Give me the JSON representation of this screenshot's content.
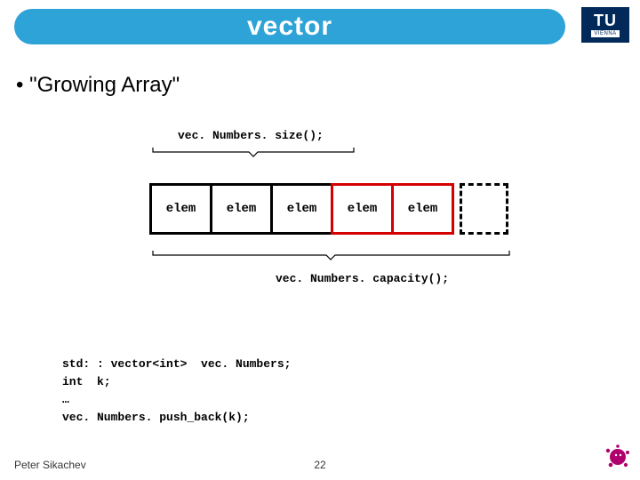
{
  "title": "vector",
  "logo": {
    "top": "TU",
    "bottom": "VIENNA"
  },
  "bullet": "• \"Growing Array\"",
  "sizeCall": "vec. Numbers. size();",
  "capacityCall": "vec. Numbers. capacity();",
  "cells": [
    "elem",
    "elem",
    "elem",
    "elem",
    "elem"
  ],
  "code": {
    "l1": "std: : vector<int>  vec. Numbers;",
    "l2": "int  k;",
    "l3": "…",
    "l4": "vec. Numbers. push_back(k);"
  },
  "footer": {
    "author": "Peter Sikachev",
    "page": "22"
  }
}
